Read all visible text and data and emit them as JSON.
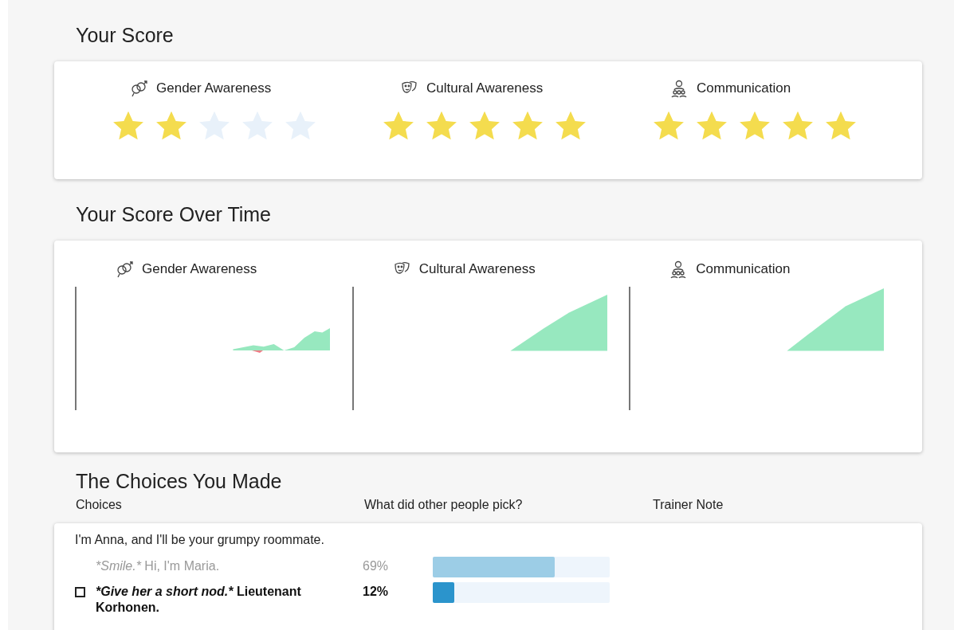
{
  "score": {
    "title": "Your Score",
    "categories": [
      {
        "kind": "gender",
        "label": "Gender Awareness",
        "stars": 2
      },
      {
        "kind": "culture",
        "label": "Cultural Awareness",
        "stars": 5
      },
      {
        "kind": "communication",
        "label": "Communication",
        "stars": 5
      }
    ]
  },
  "over_time": {
    "title": "Your Score Over Time",
    "charts": [
      {
        "kind": "gender",
        "label": "Gender Awareness"
      },
      {
        "kind": "culture",
        "label": "Cultural Awareness"
      },
      {
        "kind": "communication",
        "label": "Communication"
      }
    ]
  },
  "choices": {
    "title": "The Choices You Made",
    "columns": [
      "Choices",
      "What did other people pick?",
      "Trainer Note"
    ],
    "prompt": "I'm Anna, and I'll be your grumpy roommate.",
    "options": [
      {
        "action": "*Smile.*",
        "line": "Hi, I'm Maria.",
        "percent": "69%",
        "level": 0.69,
        "chosen": false
      },
      {
        "action": "*Give her a short nod.*",
        "line": "Lieutenant Korhonen.",
        "percent": "12%",
        "level": 0.12,
        "chosen": true
      }
    ]
  }
}
